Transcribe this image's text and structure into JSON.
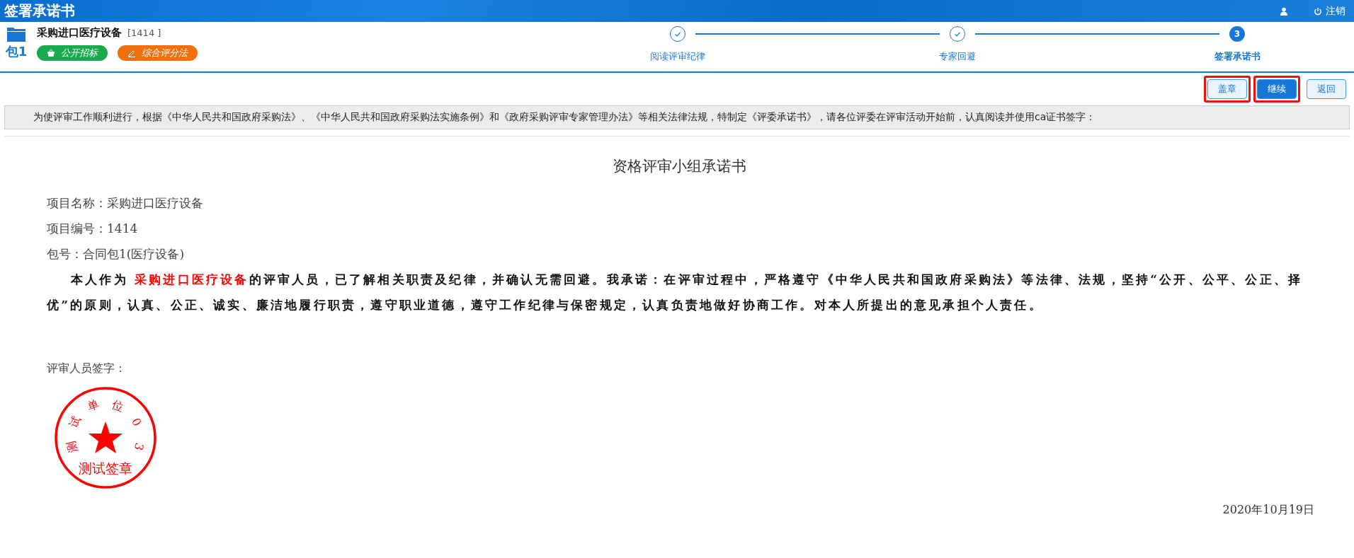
{
  "header": {
    "title": "签署承诺书",
    "logout": "注销"
  },
  "project": {
    "name": "采购进口医疗设备",
    "code": "[1414 ]",
    "package": "包1",
    "tags": [
      {
        "kind": "bid",
        "label": "公开招标",
        "color": "#1aa94d"
      },
      {
        "kind": "score",
        "label": "综合评分法",
        "color": "#f07010"
      }
    ]
  },
  "steps": [
    {
      "label": "阅读评审纪律",
      "completed": true
    },
    {
      "label": "专家回避",
      "completed": true
    },
    {
      "label": "签署承诺书",
      "completed": false,
      "number": "3"
    }
  ],
  "buttons": [
    {
      "label": "盖章",
      "primary": false,
      "highlighted": true
    },
    {
      "label": "继续",
      "primary": true,
      "highlighted": true
    },
    {
      "label": "返回",
      "primary": false,
      "highlighted": false
    }
  ],
  "notice": "为使评审工作顺利进行，根据《中华人民共和国政府采购法》、《中华人民共和国政府采购法实施条例》和《政府采购评审专家管理办法》等相关法律法规，特制定《评委承诺书》，请各位评委在评审活动开始前，认真阅读并使用ca证书签字：",
  "document": {
    "title": "资格评审小组承诺书",
    "fields": [
      "项目名称：采购进口医疗设备",
      "项目编号：1414",
      "包号：合同包1(医疗设备)"
    ],
    "paragraph": [
      {
        "text": "本人作为 ",
        "highlight": false
      },
      {
        "text": "采购进口医疗设备",
        "highlight": true
      },
      {
        "text": "的评审人员，已了解相关职责及纪律，并确认无需回避。我承诺：在评审过程中，严格遵守《中华人民共和国政府采购法》等法律、法规，坚持“公开、公平、公正、择优”的原则，认真、公正、诚实、廉洁地履行职责，遵守职业道德，遵守工作纪律与保密规定，认真负责地做好协商工作。对本人所提出的意见承担个人责任。",
        "highlight": false
      }
    ],
    "signature_label": "评审人员签字：",
    "seal": {
      "arc_text": "测试单位03",
      "label": "测试签章"
    },
    "date": "2020年10月19日"
  }
}
